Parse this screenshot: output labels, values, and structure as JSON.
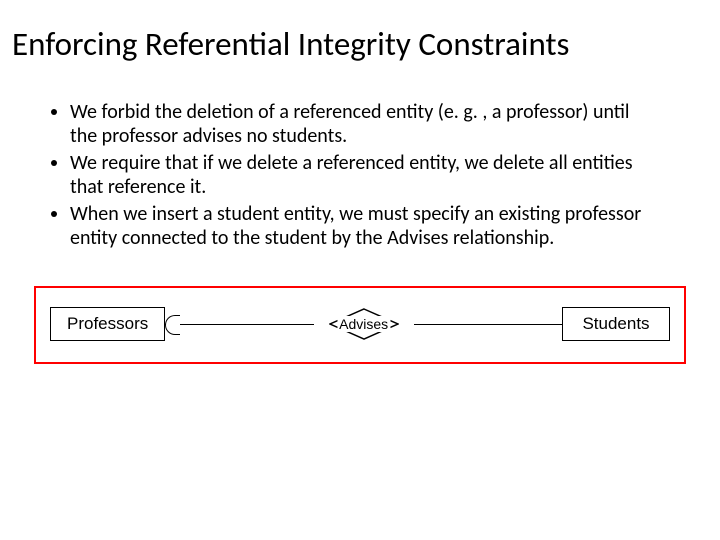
{
  "title": "Enforcing Referential Integrity Constraints",
  "bullets": [
    "We forbid the deletion of a referenced entity (e. g. , a professor) until the professor advises no students.",
    "We require that if we delete a referenced entity, we delete all entities that reference it.",
    "When we insert a student entity, we must specify an existing professor entity connected to the student by the Advises relationship."
  ],
  "diagram": {
    "left_entity": "Professors",
    "relationship": "Advises",
    "right_entity": "Students"
  }
}
